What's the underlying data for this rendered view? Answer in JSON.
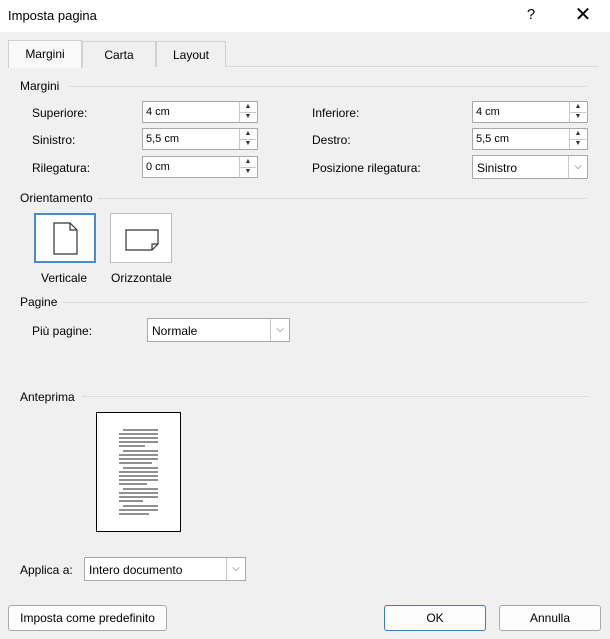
{
  "window": {
    "title": "Imposta pagina",
    "help_label": "?",
    "close_label": "✕"
  },
  "tabs": [
    {
      "label": "Margini",
      "active": true
    },
    {
      "label": "Carta",
      "active": false
    },
    {
      "label": "Layout",
      "active": false
    }
  ],
  "margins": {
    "section_label": "Margini",
    "top": {
      "label": "Superiore:",
      "value": "4 cm"
    },
    "bottom": {
      "label": "Inferiore:",
      "value": "4 cm"
    },
    "left": {
      "label": "Sinistro:",
      "value": "5,5 cm"
    },
    "right": {
      "label": "Destro:",
      "value": "5,5 cm"
    },
    "gutter": {
      "label": "Rilegatura:",
      "value": "0 cm"
    },
    "gutter_position": {
      "label": "Posizione rilegatura:",
      "value": "Sinistro"
    }
  },
  "orientation": {
    "section_label": "Orientamento",
    "portrait_label": "Verticale",
    "landscape_label": "Orizzontale",
    "selected": "portrait"
  },
  "pages": {
    "section_label": "Pagine",
    "multiple_label": "Più pagine:",
    "multiple_value": "Normale"
  },
  "preview": {
    "section_label": "Anteprima"
  },
  "apply": {
    "label": "Applica a:",
    "value": "Intero documento"
  },
  "buttons": {
    "set_default": "Imposta come predefinito",
    "ok": "OK",
    "cancel": "Annulla"
  }
}
